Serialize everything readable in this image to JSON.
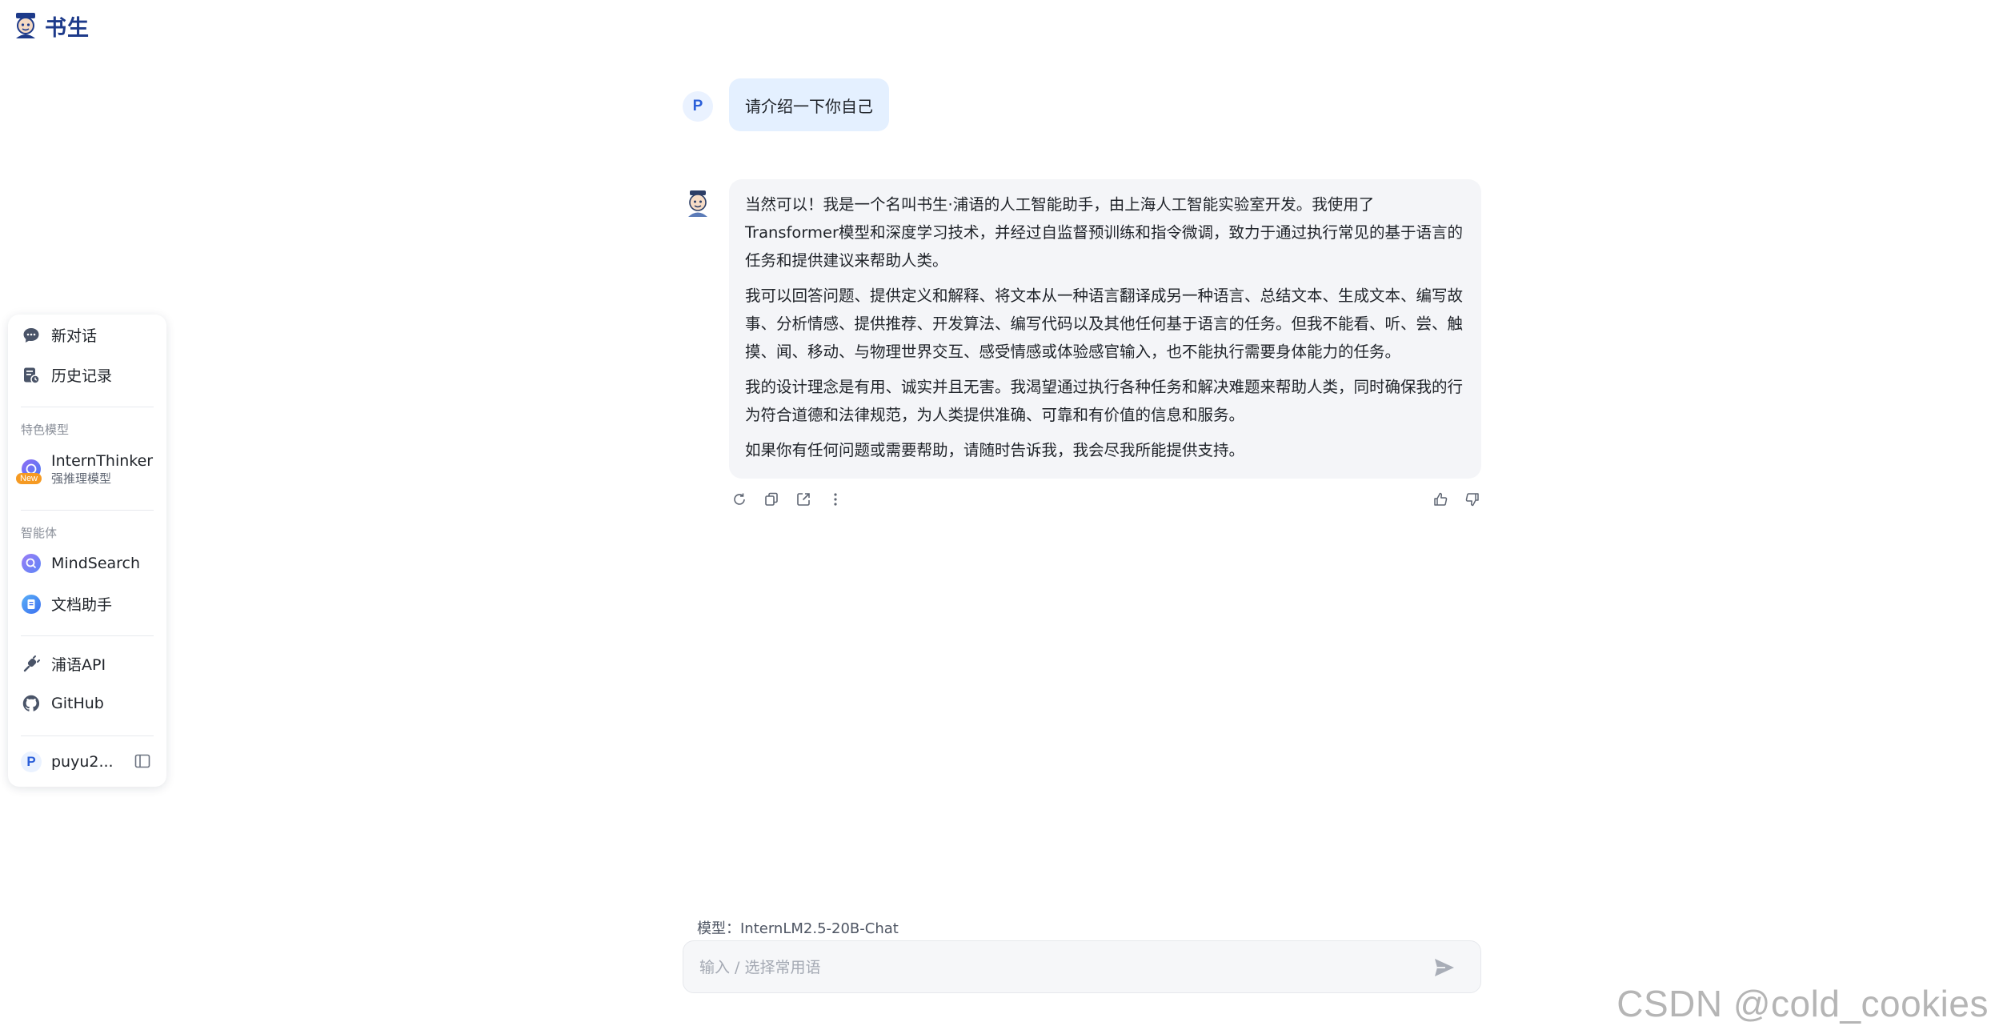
{
  "brand": {
    "logo_text": "书生",
    "brand_color": "#1d3a8a"
  },
  "sidebar": {
    "new_chat": "新对话",
    "history": "历史记录",
    "section_featured": "特色模型",
    "featured_model": {
      "name": "InternThinker",
      "subtitle": "强推理模型",
      "badge": "New"
    },
    "section_agents": "智能体",
    "agents": [
      {
        "label": "MindSearch",
        "icon": "mindsearch-icon"
      },
      {
        "label": "文档助手",
        "icon": "document-assistant-icon"
      }
    ],
    "links": [
      {
        "label": "浦语API",
        "icon": "api-icon"
      },
      {
        "label": "GitHub",
        "icon": "github-icon"
      }
    ],
    "user": {
      "avatar_letter": "P",
      "name": "puyu2..."
    }
  },
  "conversation": {
    "user_avatar_letter": "P",
    "user_message": "请介绍一下你自己",
    "assistant_paragraphs": [
      "当然可以！我是一个名叫书生·浦语的人工智能助手，由上海人工智能实验室开发。我使用了Transformer模型和深度学习技术，并经过自监督预训练和指令微调，致力于通过执行常见的基于语言的任务和提供建议来帮助人类。",
      "我可以回答问题、提供定义和解释、将文本从一种语言翻译成另一种语言、总结文本、生成文本、编写故事、分析情感、提供推荐、开发算法、编写代码以及其他任何基于语言的任务。但我不能看、听、尝、触摸、闻、移动、与物理世界交互、感受情感或体验感官输入，也不能执行需要身体能力的任务。",
      "我的设计理念是有用、诚实并且无害。我渴望通过执行各种任务和解决难题来帮助人类，同时确保我的行为符合道德和法律规范，为人类提供准确、可靠和有价值的信息和服务。",
      "如果你有任何问题或需要帮助，请随时告诉我，我会尽我所能提供支持。"
    ],
    "message_actions": [
      "regenerate-icon",
      "copy-icon",
      "share-icon",
      "more-icon"
    ],
    "feedback_actions": [
      "thumbs-up-icon",
      "thumbs-down-icon"
    ]
  },
  "composer": {
    "model_label": "模型：InternLM2.5-20B-Chat",
    "placeholder": "输入 / 选择常用语",
    "value": ""
  },
  "watermark": "CSDN @cold_cookies",
  "colors": {
    "user_bubble": "#e4f0ff",
    "assistant_bubble": "#f4f5f8",
    "accent": "#2b5fd9"
  }
}
